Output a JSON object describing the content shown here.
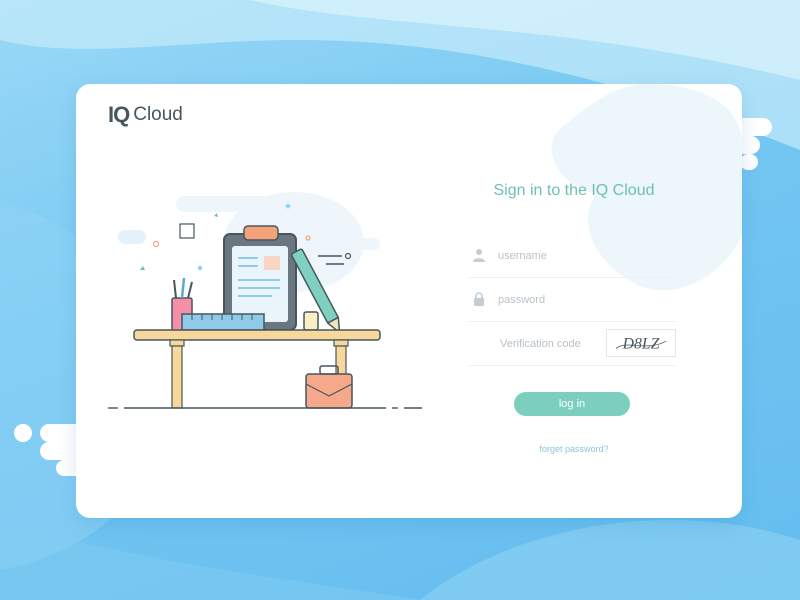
{
  "brand": {
    "logo_mark": "IQ",
    "logo_text": "Cloud"
  },
  "login": {
    "title": "Sign in to the IQ Cloud",
    "username_placeholder": "username",
    "password_placeholder": "password",
    "code_placeholder": "Verification code",
    "captcha_text": "D8LZ",
    "login_label": "log in",
    "forget_label": "forget password?"
  },
  "icons": {
    "username": "user-icon",
    "password": "lock-icon"
  },
  "colors": {
    "accent": "#7ccfbf",
    "title": "#6cc1b6",
    "background": "#74c6f1",
    "link": "#8dc4dc"
  }
}
